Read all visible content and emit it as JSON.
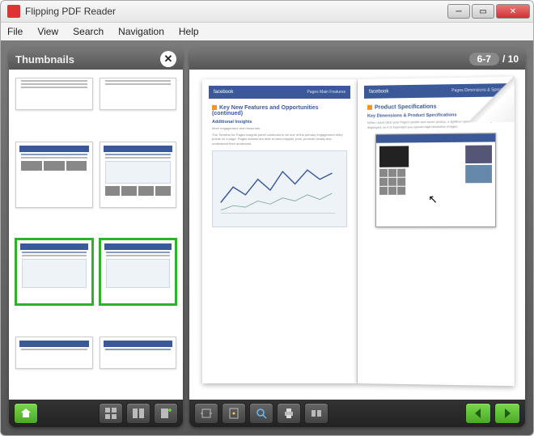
{
  "window": {
    "title": "Flipping PDF Reader"
  },
  "menu": {
    "file": "File",
    "view": "View",
    "search": "Search",
    "navigation": "Navigation",
    "help": "Help"
  },
  "thumbnails": {
    "title": "Thumbnails"
  },
  "pager": {
    "current": "6-7",
    "sep": "/",
    "total": "10"
  },
  "pages": {
    "left": {
      "brand": "facebook",
      "crumb": "Pages Main Features",
      "title": "Key New Features and Opportunities (continued)",
      "sub": "Additional Insights",
      "para1": "More engagement and resources.",
      "para2": "The Timeline for Pages insights panel continues to be one of the primary engagement entry points on a page. Pages admins are able to view insights, post, promote locally and understand their audiences.",
      "chartLabel": "Line chart"
    },
    "right": {
      "brand": "facebook",
      "crumb": "Pages Dimensions & Specs",
      "title": "Product Specifications",
      "sub": "Key Dimensions & Product Specifications",
      "para1": "When users click your Page's profile and cover photos, a lightbox opens with the image displayed, so it is important you upload high-resolution images."
    }
  },
  "icons": {
    "close": "✕",
    "home": "home",
    "thumbGrid": "grid",
    "facingPages": "facing",
    "addBookmark": "bookmark+",
    "fitWidth": "fit-width",
    "fitPage": "fit-page",
    "zoom": "zoom",
    "print": "print",
    "rotate": "rotate",
    "prev": "prev",
    "next": "next"
  },
  "colors": {
    "accent": "#3b5998",
    "select": "#2eb22e",
    "action": "#5bbd2f"
  }
}
